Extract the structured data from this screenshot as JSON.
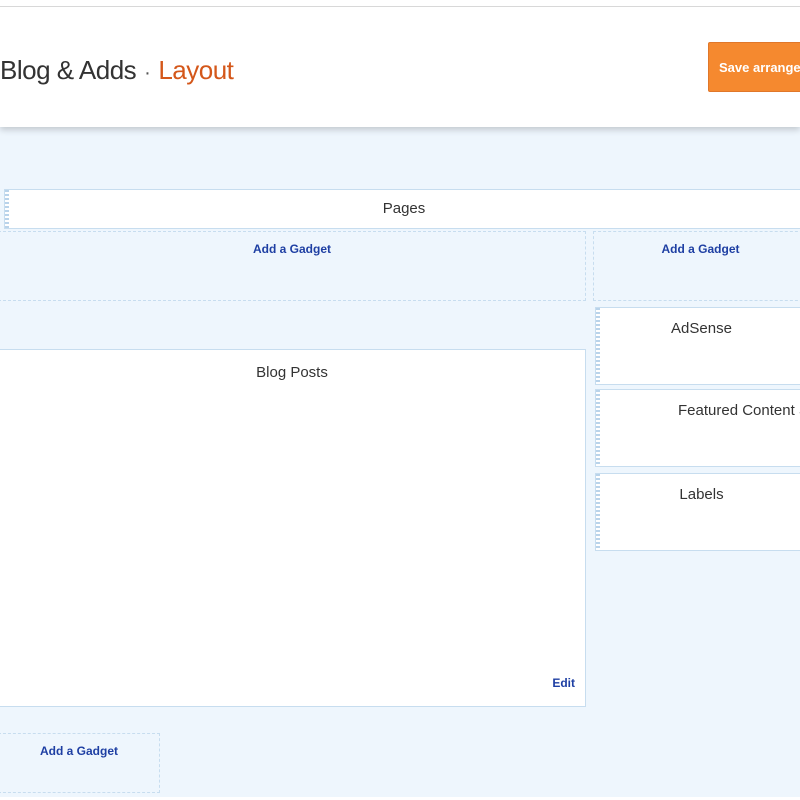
{
  "header": {
    "blog_title": "Blog & Adds",
    "separator": "·",
    "page_title": "Layout",
    "save_button": "Save arrangement"
  },
  "layout": {
    "pages_widget": "Pages",
    "add_gadget_main_top": "Add a Gadget",
    "add_gadget_sidebar_top": "Add a Gadget",
    "blog_posts_widget": "Blog Posts",
    "blog_posts_edit": "Edit",
    "add_gadget_main_bottom": "Add a Gadget",
    "sidebar_gadgets": [
      "AdSense",
      "Featured Content Slider",
      "Labels"
    ]
  },
  "colors": {
    "accent": "#d4571a",
    "button": "#f5892f",
    "link": "#1e3fa3",
    "canvas": "#eef6fd"
  }
}
